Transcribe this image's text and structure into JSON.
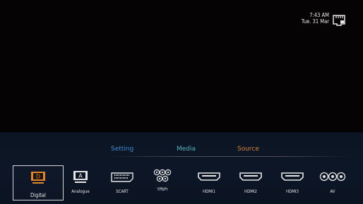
{
  "status": {
    "time": "7:43 AM",
    "date": "Tue. 31 Mar",
    "network_icon": "network-port-icon"
  },
  "tabs": [
    {
      "label": "Setting",
      "color": "#3a8fd6"
    },
    {
      "label": "Media",
      "color": "#4fb7c2"
    },
    {
      "label": "Source",
      "color": "#d9833a"
    }
  ],
  "sources": [
    {
      "label": "Digital",
      "icon": "digital-tv-icon",
      "selected": true
    },
    {
      "label": "Analogue",
      "icon": "analogue-tv-icon"
    },
    {
      "label": "SCART",
      "icon": "scart-connector-icon"
    },
    {
      "label": "YPbPr",
      "icon": "component-connector-icon"
    },
    {
      "label": "HDMI1",
      "icon": "hdmi-connector-icon"
    },
    {
      "label": "HDMI2",
      "icon": "hdmi-connector-icon"
    },
    {
      "label": "HDMI3",
      "icon": "hdmi-connector-icon"
    },
    {
      "label": "AV",
      "icon": "av-connector-icon"
    }
  ]
}
